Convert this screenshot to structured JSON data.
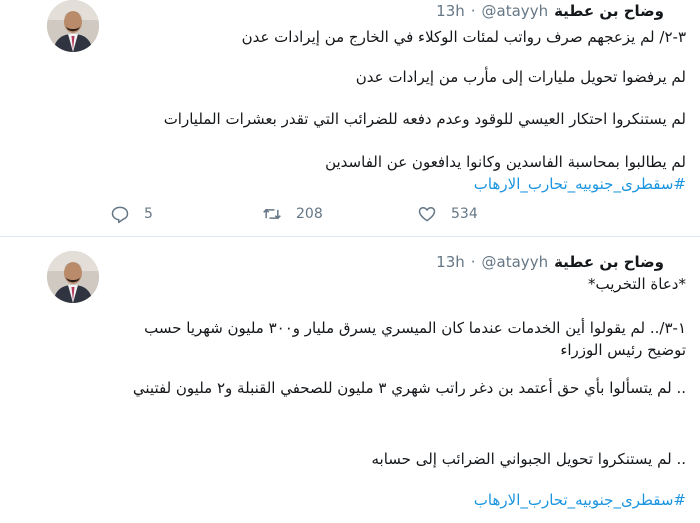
{
  "tweets": [
    {
      "name": "وضاح بن عطية",
      "handle": "@atayyh",
      "dot": "·",
      "time": "13h",
      "lines": [
        "٣-٢/ لم يزعجهم صرف رواتب لمئات الوكلاء في الخارج من إيرادات عدن",
        "لم يرفضوا تحويل مليارات إلى مأرب من إيرادات عدن",
        "لم يستنكروا احتكار العيسي للوقود وعدم دفعه للضرائب التي تقدر بعشرات المليارات",
        "لم يطالبوا بمحاسبة الفاسدين وكانوا يدافعون عن الفاسدين"
      ],
      "hashtag": "#سقطرى_جنوبيه_تحارب_الارهاب",
      "replies": "5",
      "retweets": "208",
      "likes": "534"
    },
    {
      "name": "وضاح بن عطية",
      "handle": "@atayyh",
      "dot": "·",
      "time": "13h",
      "lines": [
        "*دعاة التخريب*",
        "١-٣/.. لم يقولوا أين الخدمات عندما كان الميسري يسرق مليار و٣٠٠ مليون شهريا حسب توضيح رئيس الوزراء",
        ".. لم يتسألوا بأي حق أعتمد بن دغر راتب شهري ٣ مليون للصحفي القنبلة و٢ مليون لفتيني",
        ".. لم يستنكروا تحويل الجبواني الضرائب إلى حسابه"
      ],
      "hashtag": "#سقطرى_جنوبيه_تحارب_الارهاب"
    }
  ],
  "colors": {
    "text": "#14171a",
    "muted": "#657786",
    "link": "#1b95e0",
    "divider": "#e1e8ed"
  },
  "icons": {
    "reply": "reply-icon",
    "retweet": "retweet-icon",
    "like": "like-icon"
  }
}
